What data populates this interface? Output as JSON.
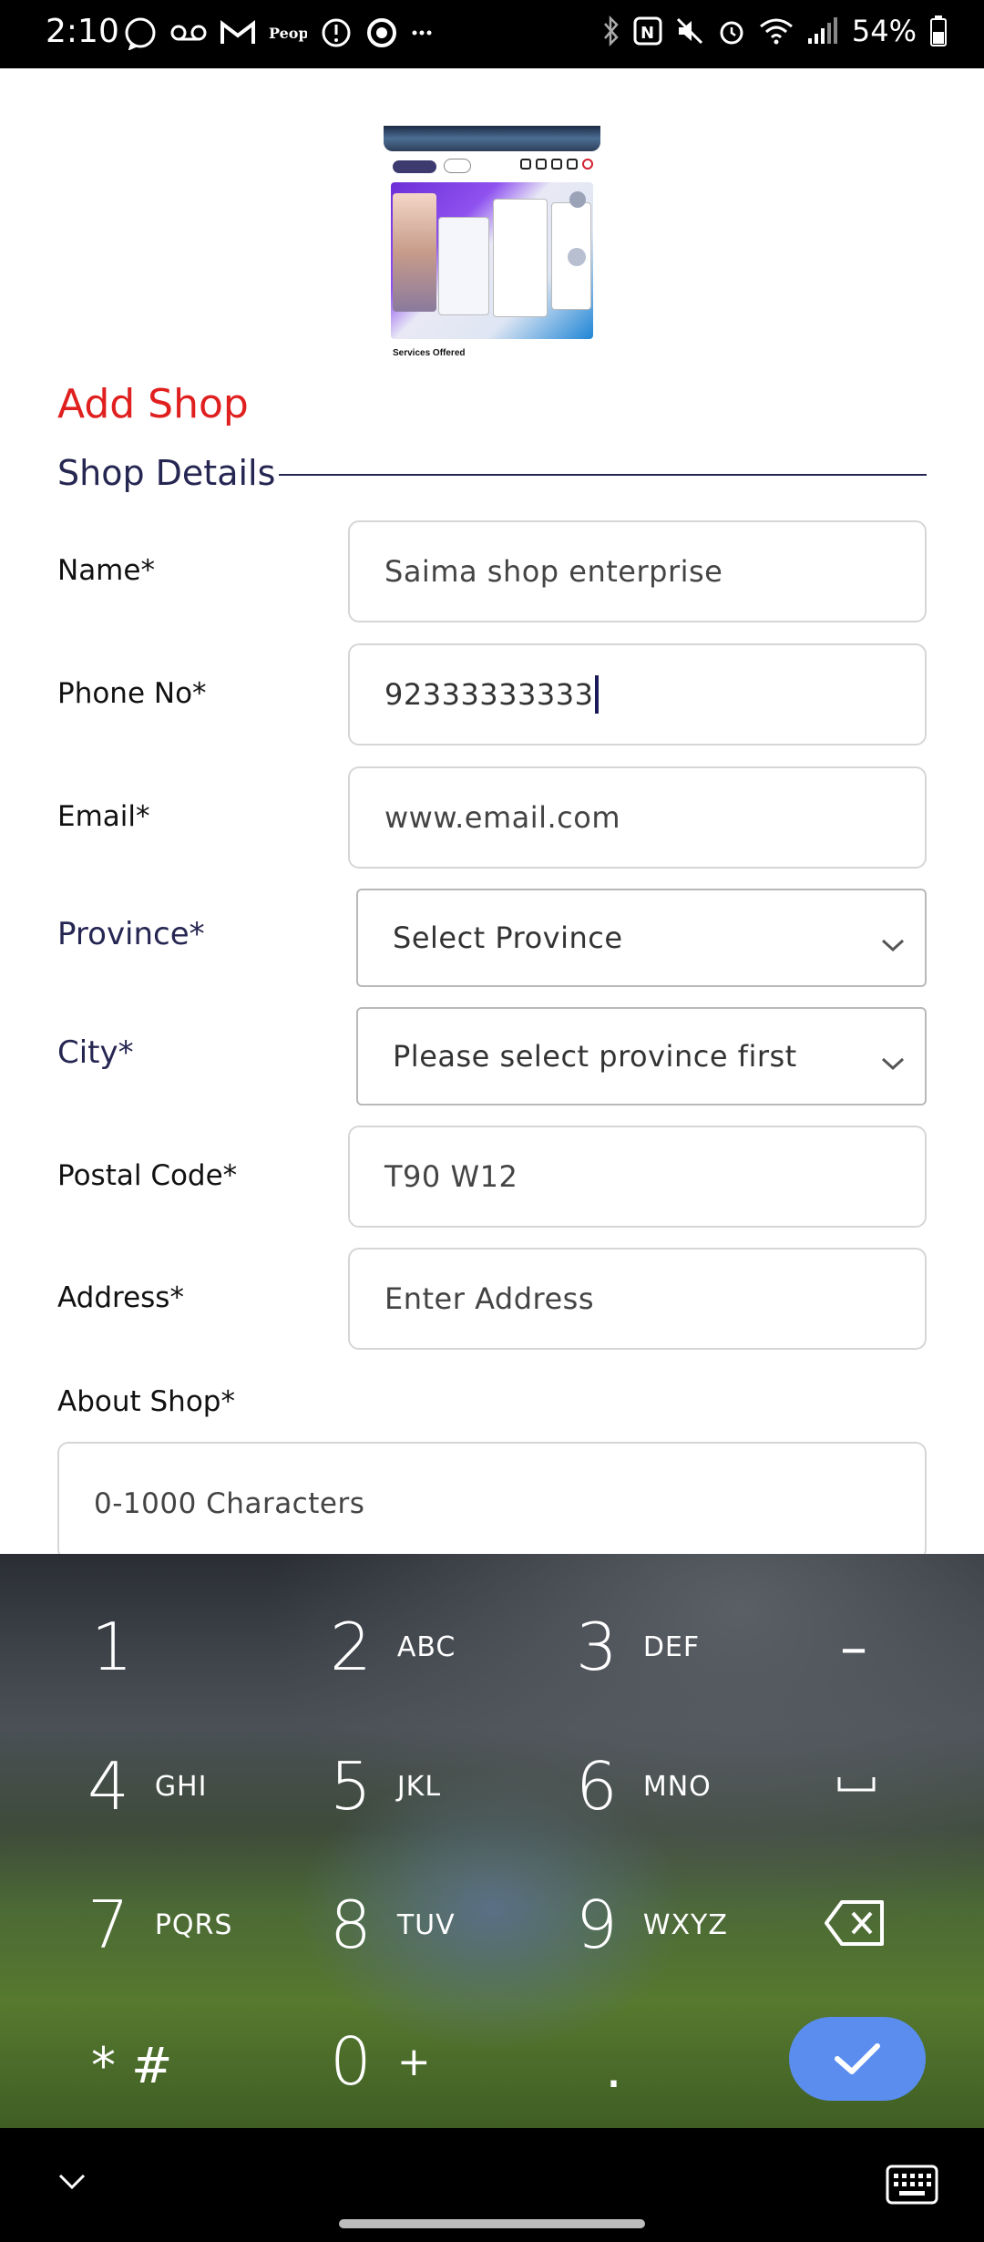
{
  "status_bar": {
    "time": "2:10",
    "battery": "54%",
    "icons_left": [
      "whatsapp-icon",
      "voicemail-icon",
      "gmail-icon",
      "people-icon",
      "alert-icon",
      "chrome-icon",
      "more-icon"
    ],
    "icons_right": [
      "bluetooth-icon",
      "nfc-icon",
      "mute-icon",
      "alarm-icon",
      "wifi-icon",
      "signal-icon",
      "battery-icon"
    ]
  },
  "preview": {
    "caption": "Services Offered"
  },
  "page": {
    "title": "Add Shop",
    "section": "Shop Details"
  },
  "form": {
    "name_label": "Name*",
    "name_value": "Saima shop enterprise",
    "phone_label": "Phone No*",
    "phone_value": "92333333333",
    "email_label": "Email*",
    "email_placeholder": "www.email.com",
    "province_label": "Province*",
    "province_selected": "Select Province",
    "city_label": "City*",
    "city_selected": "Please select province first",
    "postal_label": "Postal Code*",
    "postal_placeholder": "T90 W12",
    "address_label": "Address*",
    "address_placeholder": "Enter Address",
    "about_label": "About Shop*",
    "about_placeholder": "0-1000 Characters"
  },
  "keyboard": {
    "keys": [
      {
        "num": "1",
        "sub": ""
      },
      {
        "num": "2",
        "sub": "ABC"
      },
      {
        "num": "3",
        "sub": "DEF"
      },
      {
        "num": "4",
        "sub": "GHI"
      },
      {
        "num": "5",
        "sub": "JKL"
      },
      {
        "num": "6",
        "sub": "MNO"
      },
      {
        "num": "7",
        "sub": "PQRS"
      },
      {
        "num": "8",
        "sub": "TUV"
      },
      {
        "num": "9",
        "sub": "WXYZ"
      },
      {
        "num": "* #",
        "sub": ""
      },
      {
        "num": "0",
        "sub": "+"
      },
      {
        "num": ".",
        "sub": ""
      }
    ],
    "minus": "–"
  },
  "colors": {
    "accent_red": "#e01f1f",
    "navy": "#262653",
    "enter_blue": "#5b8def"
  }
}
